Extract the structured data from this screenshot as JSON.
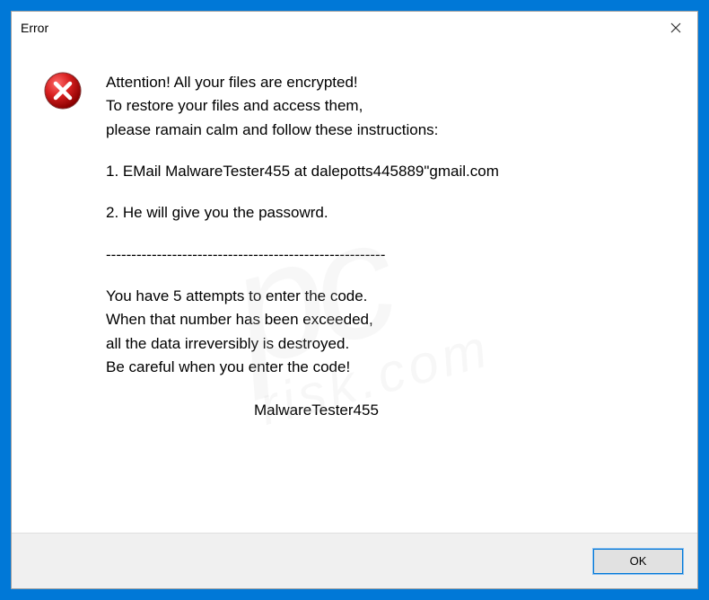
{
  "dialog": {
    "title": "Error",
    "close_label": "Close",
    "icon_name": "error-icon"
  },
  "message": {
    "line1": "Attention! All your files are encrypted!",
    "line2": "To restore your files and access them,",
    "line3": "please ramain calm and follow these instructions:",
    "line4": "1. EMail MalwareTester455 at dalepotts445889\"gmail.com",
    "line5": "2. He will give you the passowrd.",
    "divider": "-------------------------------------------------------",
    "line6": "You have 5 attempts to enter the code.",
    "line7": "When that number has been exceeded,",
    "line8": "all the data irreversibly is destroyed.",
    "line9": "Be careful when you enter the code!",
    "signature": "MalwareTester455"
  },
  "buttons": {
    "ok_label": "OK"
  }
}
